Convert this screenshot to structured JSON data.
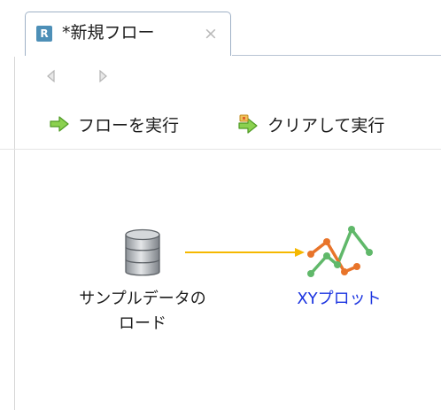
{
  "tab": {
    "icon_letter": "R",
    "title": "*新規フロー",
    "close_glyph": "×"
  },
  "toolbar": {
    "run_flow_label": "フローを実行",
    "clear_and_run_label": "クリアして実行"
  },
  "canvas": {
    "source_node": {
      "label_line1": "サンプルデータの",
      "label_line2": "ロード",
      "icon": "database-icon"
    },
    "target_node": {
      "label": "XYプロット",
      "icon": "xy-plot-icon"
    }
  },
  "colors": {
    "connector": "#f5b800",
    "link_label": "#1a33e0",
    "tab_icon": "#4d8fb7",
    "run_arrow": "#59b82d"
  }
}
